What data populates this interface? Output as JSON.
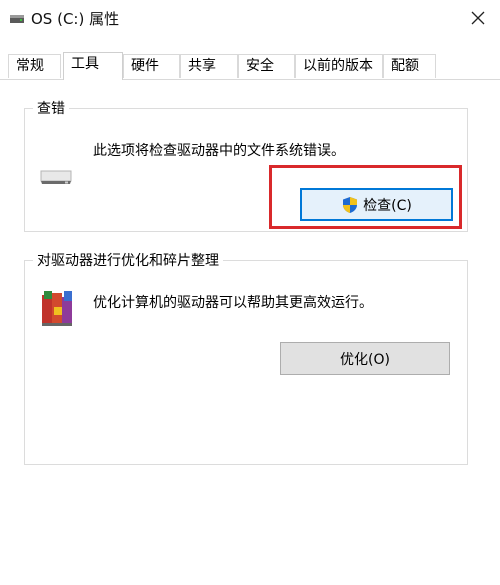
{
  "window": {
    "title": "OS (C:) 属性"
  },
  "tabs": [
    {
      "label": "常规",
      "active": false
    },
    {
      "label": "工具",
      "active": true
    },
    {
      "label": "硬件",
      "active": false
    },
    {
      "label": "共享",
      "active": false
    },
    {
      "label": "安全",
      "active": false
    },
    {
      "label": "以前的版本",
      "active": false
    },
    {
      "label": "配额",
      "active": false
    }
  ],
  "error_check": {
    "group_label": "查错",
    "description": "此选项将检查驱动器中的文件系统错误。",
    "button_label": "检查(C)"
  },
  "optimize": {
    "group_label": "对驱动器进行优化和碎片整理",
    "description": "优化计算机的驱动器可以帮助其更高效运行。",
    "button_label": "优化(O)"
  },
  "colors": {
    "highlight": "#d9292b",
    "focus": "#0078d7"
  }
}
